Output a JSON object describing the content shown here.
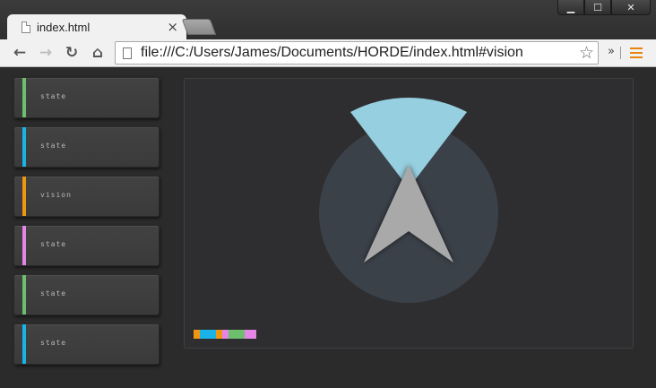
{
  "window": {
    "minimize_glyph": "▁",
    "maximize_glyph": "☐",
    "close_glyph": "✕"
  },
  "tab": {
    "title": "index.html",
    "close_glyph": "×"
  },
  "toolbar": {
    "back_glyph": "←",
    "forward_glyph": "→",
    "reload_glyph": "↻",
    "home_glyph": "⌂",
    "url": "file:///C:/Users/James/Documents/HORDE/index.html#vision",
    "star_glyph": "☆",
    "extensions_glyph": "»"
  },
  "sidebar": {
    "items": [
      {
        "label": "state",
        "color": "#6dbf6d"
      },
      {
        "label": "state",
        "color": "#1ab3e8"
      },
      {
        "label": "vision",
        "color": "#f0960f"
      },
      {
        "label": "state",
        "color": "#e585e5"
      },
      {
        "label": "state",
        "color": "#6dbf6d"
      },
      {
        "label": "state",
        "color": "#1ab3e8"
      }
    ]
  },
  "panel": {
    "radar_circle_color": "#3b4149",
    "vision_cone_color": "#96cfe0",
    "agent_color": "#a9a9a9",
    "legend_colors": [
      "#f0960f",
      "#1ab3e8",
      "#1ab3e8",
      "#f0960f",
      "#e585e5",
      "#6dbf6d",
      "#6dbf6d",
      "#e585e5",
      "#e585e5"
    ]
  }
}
